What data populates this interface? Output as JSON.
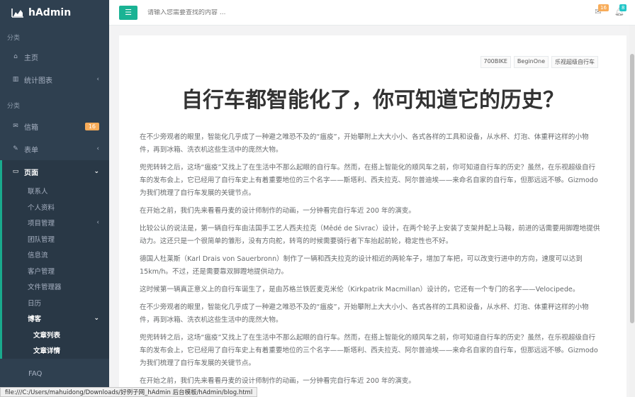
{
  "brand": {
    "name": "hAdmin",
    "icon": "area-chart-icon"
  },
  "sidebar": {
    "header1": "分类",
    "header2": "分类",
    "items": [
      {
        "label": "主页",
        "icon": "home-icon"
      },
      {
        "label": "统计图表",
        "icon": "bar-chart-icon"
      },
      {
        "label": "信箱",
        "icon": "envelope-icon",
        "badge": "16"
      },
      {
        "label": "表单",
        "icon": "edit-icon"
      },
      {
        "label": "页面",
        "icon": "desktop-icon"
      }
    ],
    "sub": [
      "联系人",
      "个人资料",
      "项目管理",
      "团队管理",
      "信息流",
      "客户管理",
      "文件管理器",
      "日历",
      "博客"
    ],
    "blog_sub": [
      "文章列表",
      "文章详情"
    ],
    "faq": "FAQ"
  },
  "topbar": {
    "search_placeholder": "请输入您需要查找的内容 ...",
    "mail_count": "16",
    "notify_count": "8"
  },
  "article": {
    "tags": [
      "700BIKE",
      "BeginOne",
      "乐视超级自行车"
    ],
    "title": "自行车都智能化了，你可知道它的历史？",
    "paragraphs": [
      "在不少旁观者的眼里，智能化几乎成了一种避之唯恐不及的“瘟疫”，开始攀附上大大小小、各式各样的工具和设备，从水杯、灯泡、体重秤这样的小物件，再到冰箱、洗衣机这些生活中的庞然大物。",
      "兜兜转转之后，这场“瘟疫”又找上了在生活中不那么起眼的自行车。然而，在搭上智能化的顺风车之前，你可知道自行车的历史？虽然，在乐视超级自行车的发布会上，它已经用了自行车史上有着重要地位的三个名字——斯塔利、西夫拉克、阿尔普迪埃——来命名自家的自行车，但那远远不够。Gizmodo 为我们梳理了自行车发展的关键节点。",
      "在开始之前，我们先来看看丹麦的设计师制作的动画，一分钟看完自行车近 200 年的演变。",
      "比较公认的说法是，第一辆自行车由法国手工艺人西夫拉克（Mêdé de Sivrac）设计，在两个轮子上安装了支架并配上马鞍，前进的话需要用脚蹬地提供动力。这还只是一个很简单的雏形，没有方向舵，转弯的时候需要骑行者下车抬起前轮，稳定性也不好。",
      "德国人杜莱斯（Karl Drais von Sauerbronn）制作了一辆和西夫拉克的设计相近的两轮车子，增加了车把，可以改变行进中的方向，速度可以达到 15km/h。不过，还是需要靠双脚蹬地提供动力。",
      "这时候第一辆真正意义上的自行车诞生了，是由苏格兰铁匠麦克米伦（Kirkpatrik Macmillan）设计的，它还有一个专门的名字——Velocipede。",
      "在不少旁观者的眼里，智能化几乎成了一种避之唯恐不及的“瘟疫”，开始攀附上大大小小、各式各样的工具和设备，从水杯、灯泡、体重秤这样的小物件，再到冰箱、洗衣机这些生活中的庞然大物。",
      "兜兜转转之后，这场“瘟疫”又找上了在生活中不那么起眼的自行车。然而，在搭上智能化的顺风车之前，你可知道自行车的历史？虽然，在乐视超级自行车的发布会上，它已经用了自行车史上有着重要地位的三个名字——斯塔利、西夫拉克、阿尔普迪埃——来命名自家的自行车，但那远远不够。Gizmodo 为我们梳理了自行车发展的关键节点。",
      "在开始之前，我们先来看看丹麦的设计师制作的动画，一分钟看完自行车近 200 年的演变。"
    ]
  },
  "status": "file:///C:/Users/mahuidong/Downloads/好例子网_hAdmin 后台模板/hAdmin/blog.html",
  "colors": {
    "sidebar": "#2f4050",
    "accent": "#1ab394",
    "badge_orange": "#f8ac59",
    "badge_blue": "#23c6c8"
  }
}
